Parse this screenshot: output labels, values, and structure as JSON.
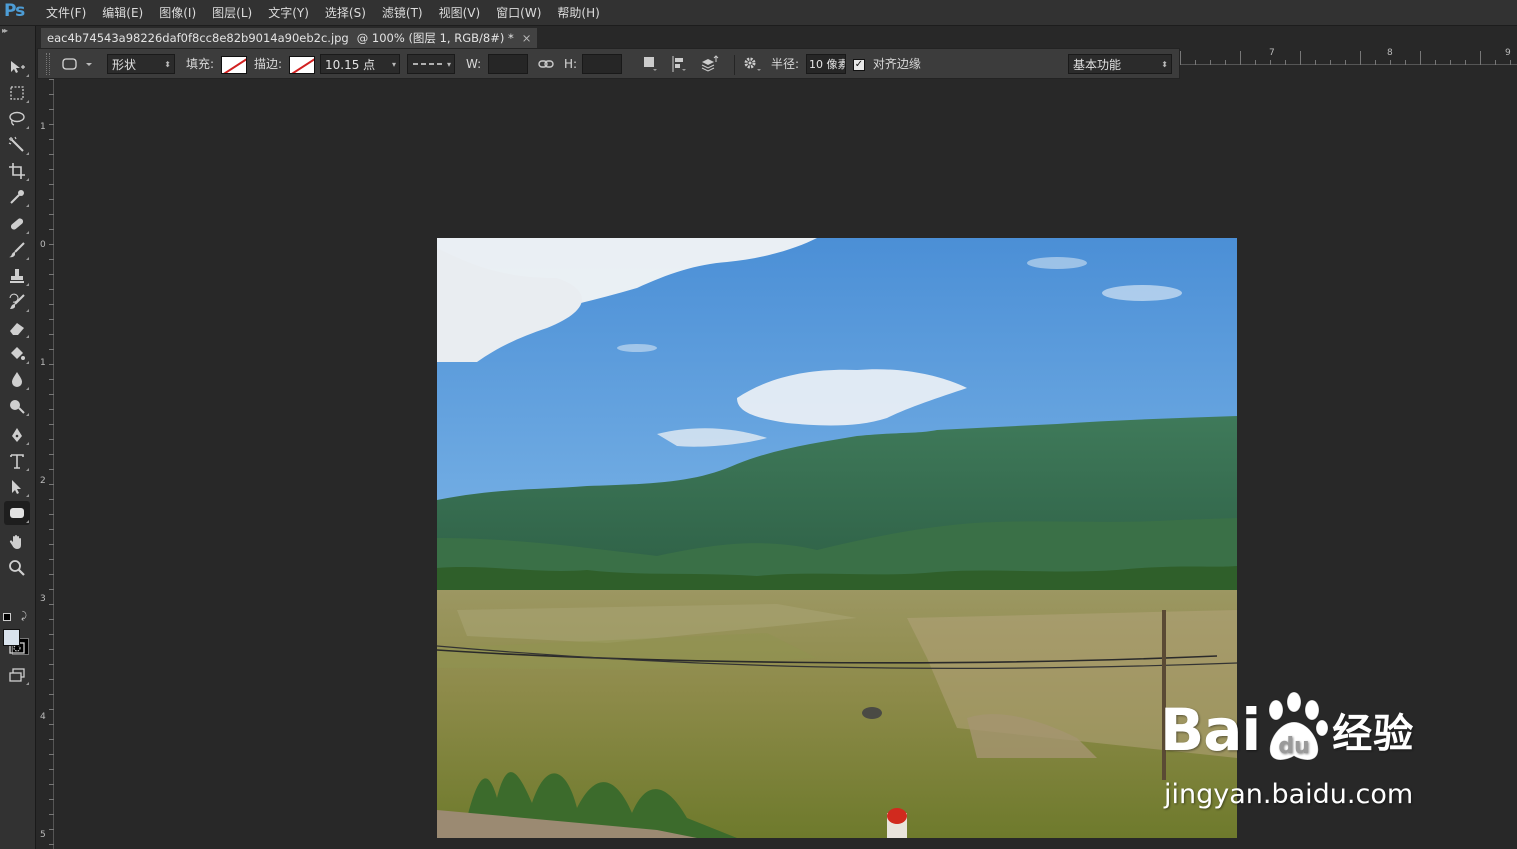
{
  "app": {
    "logo": "Ps"
  },
  "menu": [
    "文件(F)",
    "编辑(E)",
    "图像(I)",
    "图层(L)",
    "文字(Y)",
    "选择(S)",
    "滤镜(T)",
    "视图(V)",
    "窗口(W)",
    "帮助(H)"
  ],
  "document_tab": {
    "filename": "eac4b74543a98226daf0f8cc8e82b9014a90eb2c.jpg",
    "info": "@ 100% (图层 1, RGB/8#) *",
    "close": "×"
  },
  "options": {
    "mode_value": "形状",
    "fill_label": "填充:",
    "stroke_label": "描边:",
    "stroke_width": "10.15 点",
    "w_label": "W:",
    "h_label": "H:",
    "radius_label": "半径:",
    "radius_value": "10 像素",
    "align_edges_label": "对齐边缘",
    "align_edges_checked": true,
    "workspace_value": "基本功能"
  },
  "ruler_top": [
    "7",
    "8",
    "9"
  ],
  "ruler_left": [
    "1",
    "0",
    "1",
    "2",
    "3",
    "4",
    "5"
  ],
  "tools": [
    "move-tool",
    "marquee-tool",
    "lasso-tool",
    "magic-wand-tool",
    "crop-tool",
    "eyedropper-tool",
    "healing-brush-tool",
    "brush-tool",
    "clone-stamp-tool",
    "history-brush-tool",
    "eraser-tool",
    "paint-bucket-tool",
    "blur-tool",
    "dodge-tool",
    "pen-tool",
    "type-tool",
    "path-selection-tool",
    "rounded-rectangle-tool",
    "hand-tool",
    "zoom-tool"
  ],
  "colors": {
    "foreground": "#d9e3ed",
    "background": "#000000",
    "accent": "#4d9dd6"
  },
  "watermark": {
    "brand_left": "Bai",
    "brand_right": "经验",
    "url": "jingyan.baidu.com"
  }
}
